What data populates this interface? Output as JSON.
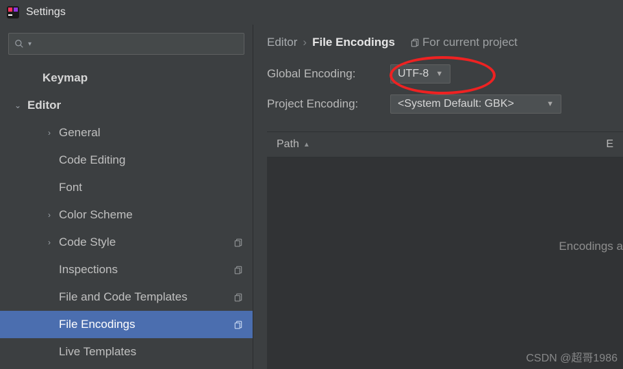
{
  "window": {
    "title": "Settings"
  },
  "search": {
    "placeholder": ""
  },
  "tree": {
    "items": [
      {
        "label": "Keymap",
        "depth": 1,
        "bold": true,
        "arrow": ""
      },
      {
        "label": "Editor",
        "depth": 0,
        "bold": true,
        "arrow": "v"
      },
      {
        "label": "General",
        "depth": 2,
        "arrow": ">"
      },
      {
        "label": "Code Editing",
        "depth": 2,
        "arrow": ""
      },
      {
        "label": "Font",
        "depth": 2,
        "arrow": ""
      },
      {
        "label": "Color Scheme",
        "depth": 2,
        "arrow": ">"
      },
      {
        "label": "Code Style",
        "depth": 2,
        "arrow": ">",
        "copy": true
      },
      {
        "label": "Inspections",
        "depth": 2,
        "arrow": "",
        "copy": true
      },
      {
        "label": "File and Code Templates",
        "depth": 2,
        "arrow": "",
        "copy": true
      },
      {
        "label": "File Encodings",
        "depth": 2,
        "arrow": "",
        "copy": true,
        "active": true
      },
      {
        "label": "Live Templates",
        "depth": 2,
        "arrow": ""
      }
    ]
  },
  "breadcrumbs": {
    "parent": "Editor",
    "current": "File Encodings",
    "tag": "For current project"
  },
  "form": {
    "globalEncoding": {
      "label": "Global Encoding:",
      "value": "UTF-8"
    },
    "projectEncoding": {
      "label": "Project Encoding:",
      "value": "<System Default: GBK>"
    }
  },
  "table": {
    "col1": "Path",
    "col2": "E",
    "hint": "Encodings a"
  },
  "watermark": "CSDN @超哥1986"
}
